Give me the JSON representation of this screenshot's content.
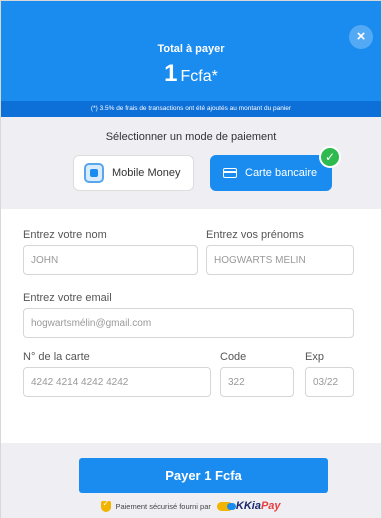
{
  "header": {
    "close_label": "×",
    "title": "Total à payer",
    "amount": "1",
    "currency": "Fcfa*",
    "fee_note": "(*) 3.5% de frais de transactions ont été ajoutés au montant du panier"
  },
  "method_selector": {
    "title": "Sélectionner un mode de paiement",
    "options": [
      {
        "label": "Mobile Money",
        "selected": false,
        "icon": "mobile-money-icon"
      },
      {
        "label": "Carte bancaire",
        "selected": true,
        "icon": "credit-card-icon"
      }
    ],
    "check_mark": "✓"
  },
  "form": {
    "last_name": {
      "label": "Entrez votre nom",
      "value": "JOHN"
    },
    "first_names": {
      "label": "Entrez vos prénoms",
      "value": "HOGWARTS MÉLIN"
    },
    "email": {
      "label": "Entrez votre email",
      "value": "hogwartsmélin@gmail.com"
    },
    "card_number": {
      "label": "N° de la carte",
      "value": "4242 4214 4242 4242"
    },
    "cvc": {
      "label": "Code",
      "value": "322"
    },
    "expiry": {
      "label": "Exp",
      "value": "03/22"
    }
  },
  "pay_button": {
    "label": "Payer 1 Fcfa"
  },
  "footer": {
    "secure_text": "Paiement sécurisé fourni par",
    "brand_k": "KKia",
    "brand_pay": "Pay"
  },
  "colors": {
    "primary": "#1a8cf0",
    "primary_dark": "#0d6fd8",
    "success": "#2fba50",
    "panel": "#efeef3"
  }
}
